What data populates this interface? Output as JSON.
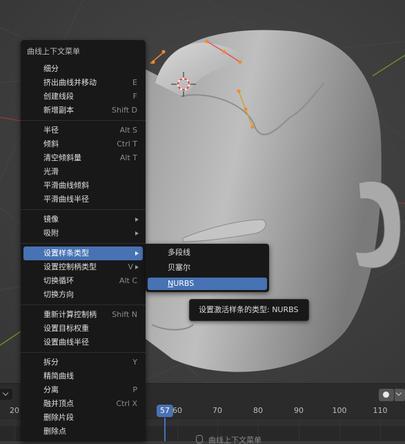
{
  "context_menu": {
    "title": "曲线上下文菜单",
    "groups": [
      [
        {
          "label": "细分",
          "shortcut": ""
        },
        {
          "label": "挤出曲线并移动",
          "shortcut": "E"
        },
        {
          "label": "创建线段",
          "shortcut": "F"
        },
        {
          "label": "新增副本",
          "shortcut": "Shift D"
        }
      ],
      [
        {
          "label": "半径",
          "shortcut": "Alt S"
        },
        {
          "label": "倾斜",
          "shortcut": "Ctrl T"
        },
        {
          "label": "清空倾斜量",
          "shortcut": "Alt T"
        },
        {
          "label": "光滑",
          "shortcut": ""
        },
        {
          "label": "平滑曲线倾斜",
          "shortcut": ""
        },
        {
          "label": "平滑曲线半径",
          "shortcut": ""
        }
      ],
      [
        {
          "label": "镜像",
          "shortcut": "",
          "submenu": true
        },
        {
          "label": "吸附",
          "shortcut": "",
          "submenu": true
        }
      ],
      [
        {
          "label": "设置样条类型",
          "shortcut": "",
          "submenu": true,
          "highlighted": true
        },
        {
          "label": "设置控制柄类型",
          "shortcut": "V",
          "submenu": true
        },
        {
          "label": "切换循环",
          "shortcut": "Alt C"
        },
        {
          "label": "切换方向",
          "shortcut": ""
        }
      ],
      [
        {
          "label": "重新计算控制柄",
          "shortcut": "Shift N"
        },
        {
          "label": "设置目标权重",
          "shortcut": ""
        },
        {
          "label": "设置曲线半径",
          "shortcut": ""
        }
      ],
      [
        {
          "label": "拆分",
          "shortcut": "Y"
        },
        {
          "label": "精简曲线",
          "shortcut": ""
        },
        {
          "label": "分离",
          "shortcut": "P"
        },
        {
          "label": "融并顶点",
          "shortcut": "Ctrl X"
        },
        {
          "label": "删除片段",
          "shortcut": ""
        },
        {
          "label": "删除点",
          "shortcut": ""
        }
      ]
    ]
  },
  "submenu": {
    "items": [
      {
        "label": "多段线"
      },
      {
        "label": "贝塞尔"
      },
      {
        "label": "NURBS",
        "highlighted": true
      }
    ]
  },
  "tooltip": {
    "text": "设置激活样条的类型: NURBS"
  },
  "timeline": {
    "current_frame": "57",
    "ticks": [
      "20",
      "60",
      "70",
      "80",
      "90",
      "100",
      "110"
    ],
    "status_hint": "曲线上下文菜单"
  },
  "colors": {
    "accent": "#4772b3",
    "menu_bg": "#181818",
    "handle_orange": "#f08a2c",
    "handle_red": "#e8504a",
    "handle_yellow": "#d1a032"
  }
}
